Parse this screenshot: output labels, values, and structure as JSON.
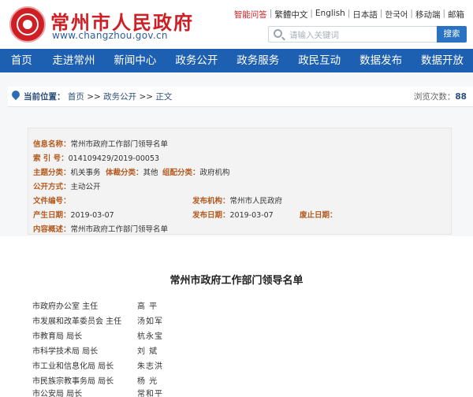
{
  "header": {
    "site_title": "常州市人民政府",
    "site_url": "www.changzhou.gov.cn",
    "top_links": [
      "智能问答",
      "繁體中文",
      "English",
      "日本語",
      "한국어",
      "移动端",
      "邮箱"
    ],
    "search_placeholder": "请输入关键词",
    "search_button": "搜索"
  },
  "nav": {
    "items": [
      "首页",
      "走进常州",
      "新闻中心",
      "政务公开",
      "政务服务",
      "政民互动",
      "数据发布",
      "数据开放"
    ]
  },
  "breadcrumb": {
    "label": "当前位置：",
    "items": [
      "首页",
      ">>",
      "政务公开",
      ">>",
      "正文"
    ],
    "views_label": "浏览次数：",
    "views_count": "88"
  },
  "info": {
    "name_label": "信息名称：",
    "name_value": "常州市政府工作部门领导名单",
    "index_label": "索 引 号：",
    "index_value": "014109429/2019-00053",
    "topic_label": "主题分类：",
    "topic_value": "机关事务",
    "genre_label": "体裁分类：",
    "genre_value": "其他",
    "org_label": "组配分类：",
    "org_value": "政府机构",
    "mode_label": "公开方式：",
    "mode_value": "主动公开",
    "docno_label": "文件编号：",
    "docno_value": "",
    "issuer_label": "发布机构：",
    "issuer_value": "常州市人民政府",
    "created_label": "产生日期：",
    "created_value": "2019-03-07",
    "published_label": "发布日期：",
    "published_value": "2019-03-07",
    "abolished_label": "废止日期：",
    "abolished_value": "",
    "summary_label": "内容概述：",
    "summary_value": "常州市政府工作部门领导名单"
  },
  "document": {
    "title": "常州市政府工作部门领导名单",
    "leaders": [
      {
        "dept": "市政府办公室  主任",
        "name": "高  平"
      },
      {
        "dept": "市发展和改革委员会  主任",
        "name": "汤如军"
      },
      {
        "dept": "市教育局  局长",
        "name": "杭永宝"
      },
      {
        "dept": "市科学技术局  局长",
        "name": "刘  斌"
      },
      {
        "dept": "市工业和信息化局  局长",
        "name": "朱志洪"
      },
      {
        "dept": "市民族宗教事务局  局长",
        "name": "杨  光"
      },
      {
        "dept": "市公安局  局长",
        "name": "常和平"
      }
    ]
  },
  "colors": {
    "brand_red": "#cf1e24",
    "nav_blue": "#1d5fb1",
    "label_orange": "#b45a1e"
  }
}
